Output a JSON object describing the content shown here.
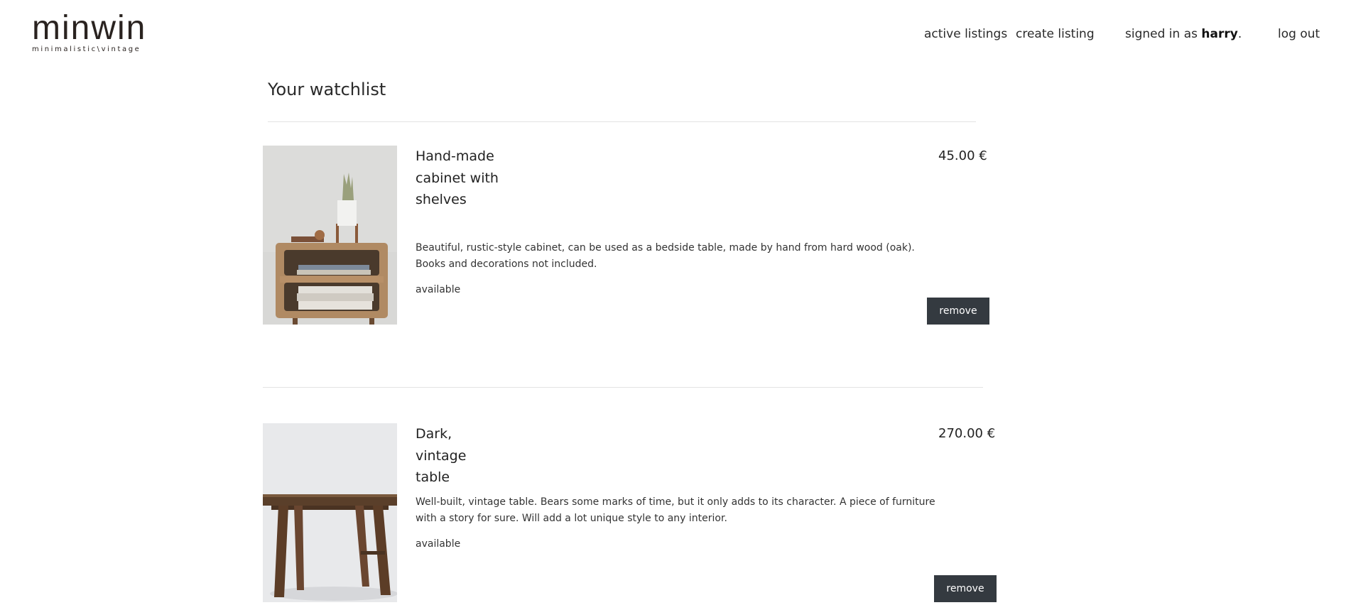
{
  "header": {
    "logo_word": "minwin",
    "logo_tagline": "minimalistic\\vintage",
    "nav": {
      "active_listings": "active listings",
      "create_listing": "create listing",
      "signed_in_prefix": "signed in as",
      "username": "harry",
      "signed_in_suffix": ".",
      "log_out": "log out"
    }
  },
  "main": {
    "page_title": "Your watchlist",
    "items": [
      {
        "title": "Hand-made cabinet with shelves",
        "price": "45.00 €",
        "description": "Beautiful, rustic-style cabinet, can be used as a bedside table, made by hand from hard wood (oak). Books and decorations not included.",
        "status": "available",
        "remove_label": "remove",
        "image_icon": "cabinet-photo"
      },
      {
        "title": "Dark, vintage table",
        "price": "270.00 €",
        "description": "Well-built, vintage table. Bears some marks of time, but it only adds to its character. A piece of furniture with a story for sure. Will add a lot unique style to any interior.",
        "status": "available",
        "remove_label": "remove",
        "image_icon": "table-photo"
      }
    ]
  },
  "colors": {
    "button_bg": "#343a40",
    "button_text": "#ffffff",
    "divider": "#e3e3e3",
    "text": "#222222"
  }
}
